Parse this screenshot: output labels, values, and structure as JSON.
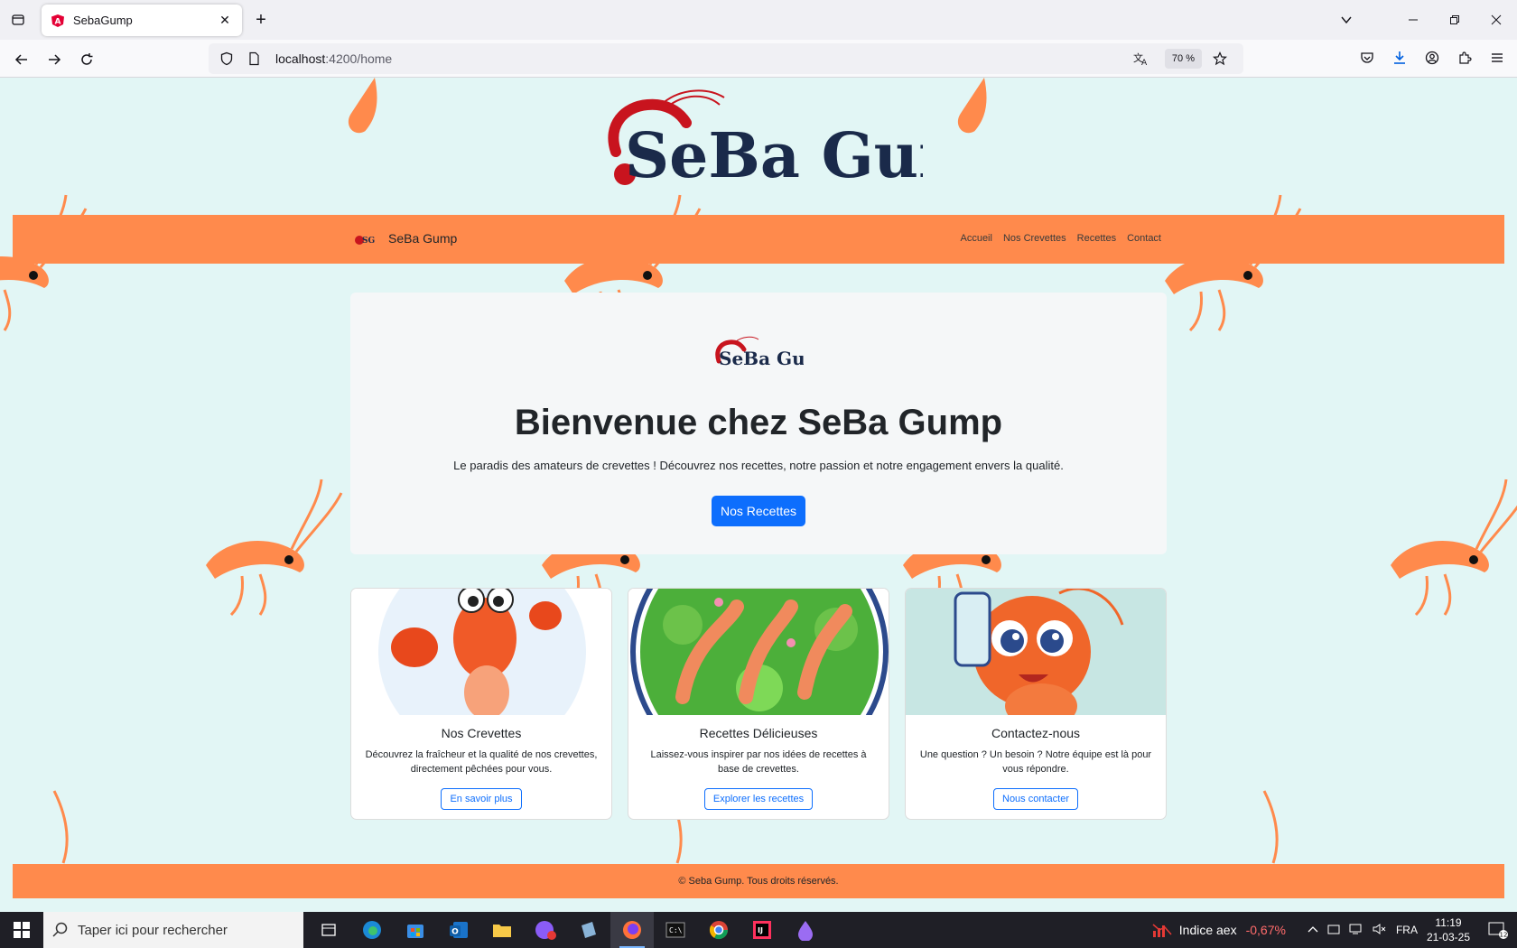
{
  "browser": {
    "tab": {
      "title": "SebaGump"
    },
    "url": {
      "host": "localhost",
      "path": ":4200/home"
    },
    "zoom": "70 %"
  },
  "site": {
    "logo_text": "SeBa Gump",
    "nav": {
      "brand": "SeBa Gump",
      "links": [
        "Accueil",
        "Nos Crevettes",
        "Recettes",
        "Contact"
      ]
    },
    "hero": {
      "title": "Bienvenue chez SeBa Gump",
      "subtitle": "Le paradis des amateurs de crevettes ! Découvrez nos recettes, notre passion et notre engagement envers la qualité.",
      "button": "Nos Recettes"
    },
    "cards": [
      {
        "title": "Nos Crevettes",
        "text": "Découvrez la fraîcheur et la qualité de nos crevettes, directement pêchées pour vous.",
        "button": "En savoir plus"
      },
      {
        "title": "Recettes Délicieuses",
        "text": "Laissez-vous inspirer par nos idées de recettes à base de crevettes.",
        "button": "Explorer les recettes"
      },
      {
        "title": "Contactez-nous",
        "text": "Une question ? Un besoin ? Notre équipe est là pour vous répondre.",
        "button": "Nous contacter"
      }
    ],
    "footer": "© Seba Gump. Tous droits réservés."
  },
  "taskbar": {
    "search_placeholder": "Taper ici pour rechercher",
    "ticker_name": "Indice aex",
    "ticker_change": "-0,67%",
    "language": "FRA",
    "time": "11:19",
    "date": "21-03-25",
    "notifications": "12"
  },
  "colors": {
    "accent": "#ff8a4c",
    "primary": "#0d6efd",
    "page_bg": "#e2f6f5",
    "logo_navy": "#1a2a4a",
    "logo_red": "#c8141e"
  }
}
